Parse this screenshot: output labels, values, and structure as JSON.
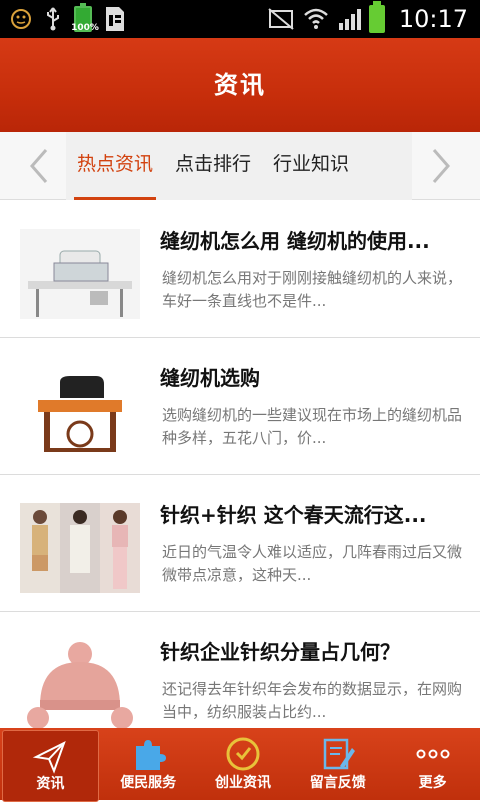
{
  "status_bar": {
    "time": "10:17",
    "battery_small_label": "100%"
  },
  "header": {
    "title": "资讯"
  },
  "tabs": [
    {
      "label": "热点资讯",
      "active": true
    },
    {
      "label": "点击排行",
      "active": false
    },
    {
      "label": "行业知识",
      "active": false
    }
  ],
  "articles": [
    {
      "title": "缝纫机怎么用 缝纫机的使用...",
      "summary": "缝纫机怎么用对于刚刚接触缝纫机的人来说，车好一条直线也不是件..."
    },
    {
      "title": "缝纫机选购",
      "summary": "选购缝纫机的一些建议现在市场上的缝纫机品种多样，五花八门，价..."
    },
    {
      "title": "针织+针织 这个春天流行这...",
      "summary": " 近日的气温令人难以适应，几阵春雨过后又微微带点凉意，这种天..."
    },
    {
      "title": "针织企业针织分量占几何？",
      "summary": "还记得去年针织年会发布的数据显示，在网购当中，纺织服装占比约..."
    }
  ],
  "bottom_nav": [
    {
      "label": "资讯",
      "icon": "paper-plane-icon",
      "active": true
    },
    {
      "label": "便民服务",
      "icon": "puzzle-icon",
      "active": false
    },
    {
      "label": "创业资讯",
      "icon": "clock-icon",
      "active": false
    },
    {
      "label": "留言反馈",
      "icon": "edit-note-icon",
      "active": false
    },
    {
      "label": "更多",
      "icon": "more-dots-icon",
      "active": false
    }
  ],
  "colors": {
    "brand": "#c92f0b",
    "active_tab": "#d2420f"
  }
}
